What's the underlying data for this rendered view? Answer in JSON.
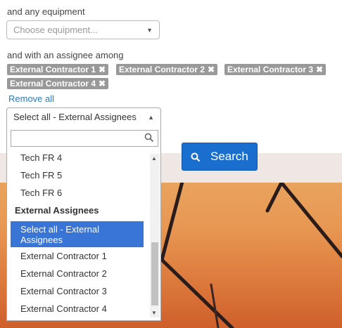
{
  "filters": {
    "equipment_label": "and any equipment",
    "equipment_placeholder": "Choose equipment...",
    "assignee_label": "and with an assignee among",
    "tags": [
      "External Contractor 1",
      "External Contractor 2",
      "External Contractor 3",
      "External Contractor 4"
    ],
    "remove_all": "Remove all"
  },
  "dropdown": {
    "selected_value": "Select all - External Assignees",
    "search_value": "",
    "options": {
      "tech4": "Tech FR 4",
      "tech5": "Tech FR 5",
      "tech6": "Tech FR 6",
      "group": "External Assignees",
      "select_all_line1": "Select all - External",
      "select_all_line2": "Assignees",
      "ec1": "External Contractor 1",
      "ec2": "External Contractor 2",
      "ec3": "External Contractor 3",
      "ec4": "External Contractor 4"
    }
  },
  "search_button": {
    "label": "Search"
  },
  "icons": {
    "caret": "chevron-down-icon",
    "remove": "close-icon",
    "search": "search-icon"
  },
  "colors": {
    "tag_bg": "#999999",
    "selected_bg": "#3875d7",
    "button_bg": "#1a6fce",
    "link": "#2a7bc4"
  }
}
